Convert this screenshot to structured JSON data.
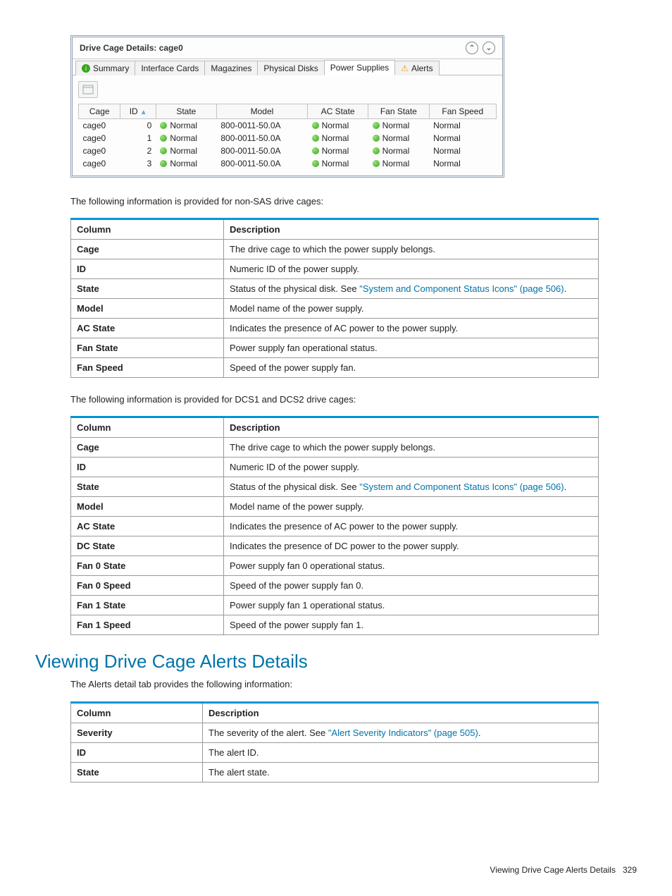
{
  "panel": {
    "title": "Drive Cage Details: cage0",
    "tabs": [
      "Summary",
      "Interface Cards",
      "Magazines",
      "Physical Disks",
      "Power Supplies",
      "Alerts"
    ],
    "selected_tab": "Power Supplies",
    "columns": [
      "Cage",
      "ID",
      "State",
      "Model",
      "AC State",
      "Fan State",
      "Fan Speed"
    ],
    "rows": [
      {
        "cage": "cage0",
        "id": "0",
        "state": "Normal",
        "model": "800-0011-50.0A",
        "ac": "Normal",
        "fan": "Normal",
        "speed": "Normal"
      },
      {
        "cage": "cage0",
        "id": "1",
        "state": "Normal",
        "model": "800-0011-50.0A",
        "ac": "Normal",
        "fan": "Normal",
        "speed": "Normal"
      },
      {
        "cage": "cage0",
        "id": "2",
        "state": "Normal",
        "model": "800-0011-50.0A",
        "ac": "Normal",
        "fan": "Normal",
        "speed": "Normal"
      },
      {
        "cage": "cage0",
        "id": "3",
        "state": "Normal",
        "model": "800-0011-50.0A",
        "ac": "Normal",
        "fan": "Normal",
        "speed": "Normal"
      }
    ]
  },
  "text": {
    "para1": "The following information is provided for non-SAS drive cages:",
    "para2": "The following information is provided for DCS1 and DCS2 drive cages:",
    "section_heading": "Viewing Drive Cage Alerts Details",
    "para3": "The Alerts detail tab provides the following information:",
    "link_text": "\"System and Component Status Icons\" (page 506)",
    "alert_link_text": "\"Alert Severity Indicators\" (page 505)"
  },
  "table_head": {
    "c1": "Column",
    "c2": "Description"
  },
  "table1": [
    {
      "c": "Cage",
      "d": "The drive cage to which the power supply belongs."
    },
    {
      "c": "ID",
      "d": "Numeric ID of the power supply."
    },
    {
      "c": "State",
      "d": "Status of the physical disk. See ",
      "link": true,
      "tail": "."
    },
    {
      "c": "Model",
      "d": "Model name of the power supply."
    },
    {
      "c": "AC State",
      "d": "Indicates the presence of AC power to the power supply."
    },
    {
      "c": "Fan State",
      "d": "Power supply fan operational status."
    },
    {
      "c": "Fan Speed",
      "d": "Speed of the power supply fan."
    }
  ],
  "table2": [
    {
      "c": "Cage",
      "d": "The drive cage to which the power supply belongs."
    },
    {
      "c": "ID",
      "d": "Numeric ID of the power supply."
    },
    {
      "c": "State",
      "d": "Status of the physical disk. See ",
      "link": true,
      "tail": "."
    },
    {
      "c": "Model",
      "d": "Model name of the power supply."
    },
    {
      "c": "AC State",
      "d": "Indicates the presence of AC power to the power supply."
    },
    {
      "c": "DC State",
      "d": "Indicates the presence of DC power to the power supply."
    },
    {
      "c": "Fan 0 State",
      "d": "Power supply fan 0 operational status."
    },
    {
      "c": "Fan 0 Speed",
      "d": "Speed of the power supply fan 0."
    },
    {
      "c": "Fan 1 State",
      "d": "Power supply fan 1 operational status."
    },
    {
      "c": "Fan 1 Speed",
      "d": "Speed of the power supply fan 1."
    }
  ],
  "table3": [
    {
      "c": "Severity",
      "d": "The severity of the alert. See ",
      "alink": true,
      "tail": "."
    },
    {
      "c": "ID",
      "d": "The alert ID."
    },
    {
      "c": "State",
      "d": "The alert state."
    }
  ],
  "footer": {
    "label": "Viewing Drive Cage Alerts Details",
    "page": "329"
  }
}
